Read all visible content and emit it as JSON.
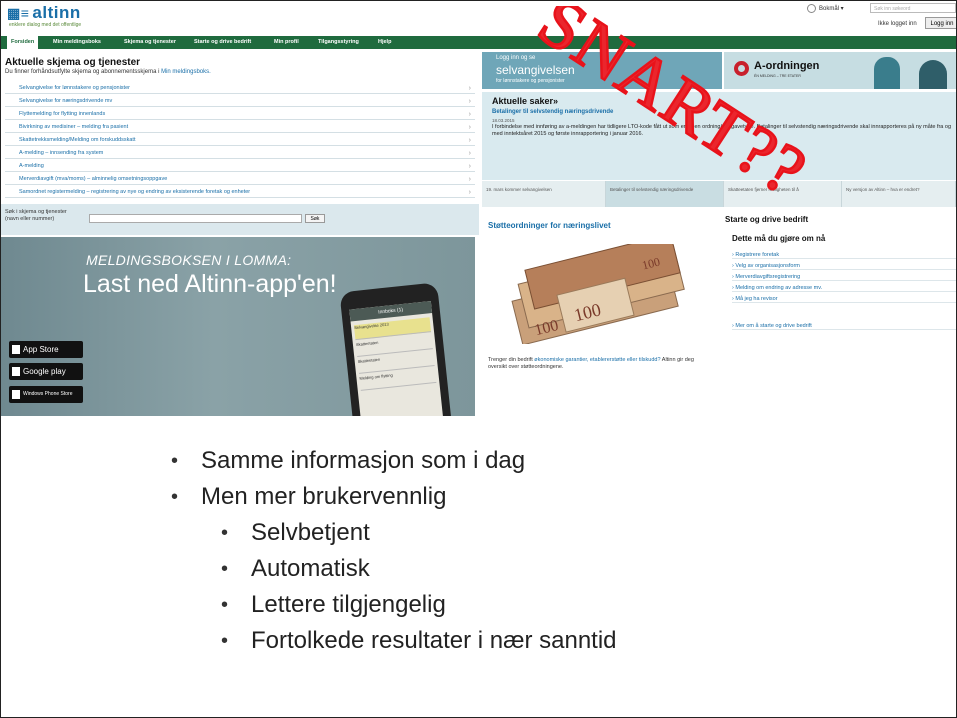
{
  "header": {
    "logo_text": "altinn",
    "tagline": "enklere dialog med det offentlige",
    "language": "Bokmål",
    "search_placeholder": "Søk inn søkeord",
    "not_logged": "Ikke logget inn",
    "login_label": "Logg inn"
  },
  "nav": [
    "Forsiden",
    "Min meldingsboks",
    "Skjema og tjenester",
    "Starte og drive bedrift",
    "Min profil",
    "Tilgangsstyring",
    "Hjelp"
  ],
  "left": {
    "title": "Aktuelle skjema og tjenester",
    "subtitle": "Du finner forhåndsutfylte skjema og abonnementsskjema i",
    "subtitle_link": "Min meldingsboks.",
    "services": [
      "Selvangivelse for lønnstakere og pensjonister",
      "Selvangivelse for næringsdrivende mv",
      "Flyttemelding for flytting innenlands",
      "Bivirkning av medisiner – melding fra pasient",
      "Skattetrekksmelding/Melding om forskuddsskatt",
      "A-melding – innsending fra system",
      "A-melding",
      "Merverdiavgift (mva/moms) – alminnelig omsetningsoppgave",
      "Samordnet registermelding – registrering av nye og endring av eksisterende foretak og enheter"
    ],
    "search_label_1": "Søk i skjema og tjenester",
    "search_label_2": "(navn eller nummer)",
    "search_button": "Søk",
    "promo_line1": "MELDINGSBOKSEN I LOMMA:",
    "promo_line2": "Last ned Altinn-app'en!",
    "badges": [
      "App Store",
      "Google play",
      "Windows Phone Store"
    ],
    "phone_title": "Innboks (1)",
    "phone_rows": [
      "Selvangivelse 2013",
      "Skatteetaten",
      "Skatteetaten",
      "Melding om flytting"
    ]
  },
  "right": {
    "top_a": "Logg inn og se",
    "top_b": "selvangivelsen",
    "top_c": "for lønnstakere og pensjonister",
    "aord_name": "A-ordningen",
    "aord_sub": "ÉN MELDING – TRE ETATER",
    "news_heading": "Aktuelle saker»",
    "news_title": "Betalinger til selvstendig næringsdrivende",
    "news_date": "18.03.2015",
    "news_text": "I forbindelse med innføring av a-meldingen har tidligere LTO-kode fått ut som en egen ordning/oppgavetype. Betalinger til selvstendig næringsdrivende skal innrapporteres på ny måte fra og med inntektsåret 2015 og første innrapportering i januar 2016.",
    "tabs": [
      "19. mars kommer selvangivelsen",
      "Betalinger til selvstendig næringsdrivende",
      "Skatteetaten fjerner muligheten til å",
      "Ny versjon av Altinn – hva er endret?"
    ],
    "stotte_title": "Støtteordninger for næringslivet",
    "note_text": "Trenger din bedrift",
    "note_link": "økonomiske garantier, etablererstøtte eller tilskudd?",
    "note_rest": "Altinn gir deg oversikt over støtteordningene.",
    "starte_title": "Starte og drive bedrift",
    "starte_sub": "Dette må du gjøre om nå",
    "starte_links": [
      "Registrere foretak",
      "Velg av organisasjonsform",
      "Merverdiavgiftsregistrering",
      "Melding om endring av adresse mv.",
      "Må jeg ha revisor"
    ],
    "starte_more": "Mer om å starte og drive bedrift"
  },
  "stamp": "SNART??",
  "bullets": {
    "level1": [
      "Samme informasjon som i dag",
      "Men mer brukervennlig"
    ],
    "level2": [
      "Selvbetjent",
      "Automatisk",
      "Lettere tilgjengelig",
      "Fortolkede resultater i nær sanntid"
    ]
  },
  "colors": {
    "nav_green": "#1f6b3e",
    "link_blue": "#1a6fa8",
    "stamp_red": "#e8131b",
    "aord_red": "#c8202c"
  }
}
